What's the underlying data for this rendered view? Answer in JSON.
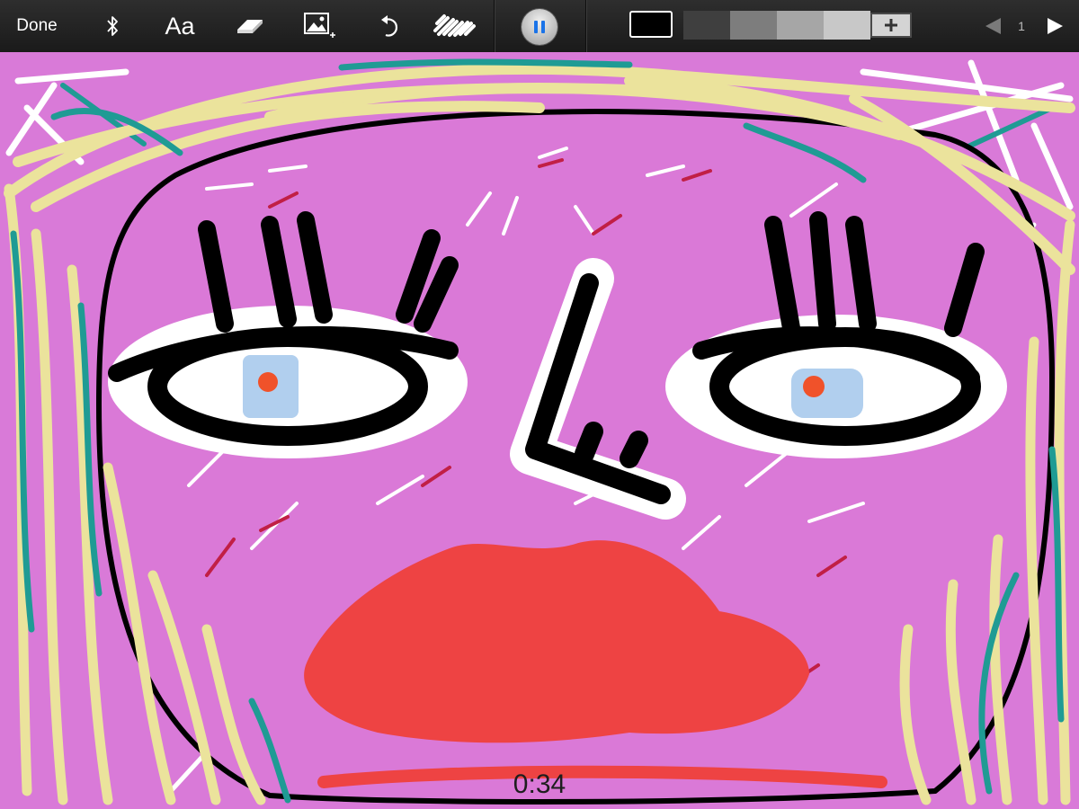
{
  "toolbar": {
    "done_label": "Done",
    "text_tool_label": "Aa",
    "icons": {
      "bluetooth": "bluetooth-icon",
      "eraser": "eraser-icon",
      "image": "image-add-icon",
      "undo": "undo-icon",
      "brush": "brush-icon",
      "pause": "pause-icon",
      "add_color": "plus-icon",
      "prev_page": "triangle-left-icon",
      "next_page": "triangle-right-icon"
    },
    "current_color": "#000000",
    "palette_colors": [
      "#3f3f3f",
      "#7d7d7d",
      "#a6a6a6",
      "#c8c8c8"
    ],
    "page_number": "1"
  },
  "playback": {
    "timer": "0:34"
  },
  "drawing_colors": {
    "background": "#d97ad8",
    "hair": "#ebe39c",
    "hair_accent": "#1f9b94",
    "outline": "#000000",
    "eye_white": "#ffffff",
    "iris": "#b1cfee",
    "pupil": "#f0522a",
    "lips": "#ee4343"
  }
}
